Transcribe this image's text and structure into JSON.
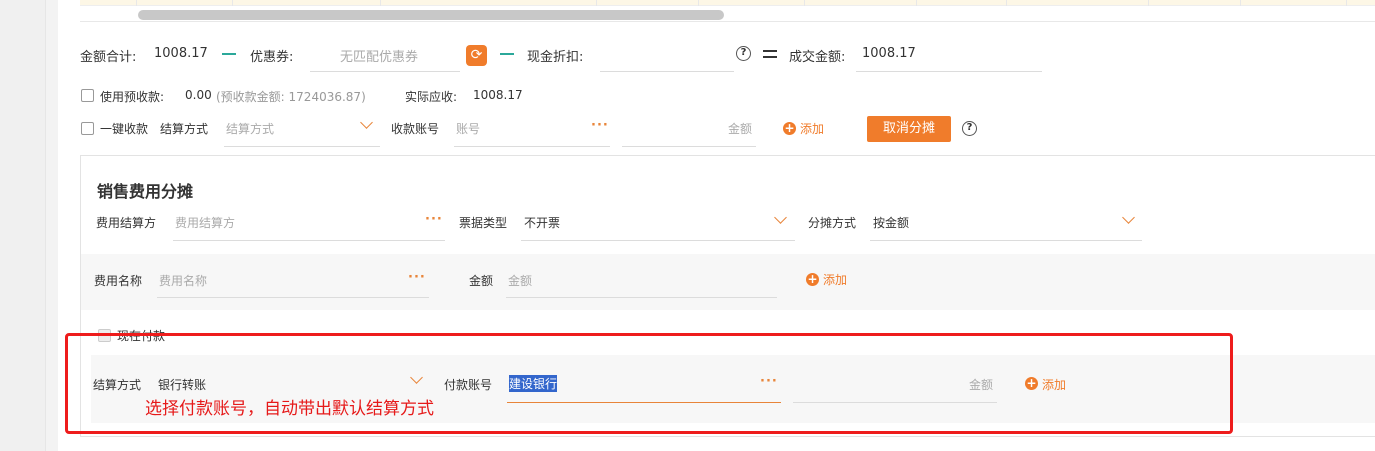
{
  "summary": {
    "total_label": "金额合计:",
    "total_value": "1008.17",
    "coupon_label": "优惠券:",
    "coupon_placeholder": "无匹配优惠券",
    "cash_discount_label": "现金折扣:",
    "deal_label": "成交金额:",
    "deal_value": "1008.17"
  },
  "prepay": {
    "label": "使用预收款:",
    "value": "0.00",
    "balance_text": "(预收款金额: 1724036.87)",
    "actual_label": "实际应收:",
    "actual_value": "1008.17"
  },
  "collect": {
    "one_click_label": "一键收款",
    "method_label": "结算方式",
    "method_placeholder": "结算方式",
    "account_label": "收款账号",
    "account_placeholder": "账号",
    "amount_placeholder": "金额",
    "add_label": "添加",
    "cancel_alloc_label": "取消分摊"
  },
  "allocation": {
    "title": "销售费用分摊",
    "settler_label": "费用结算方",
    "settler_placeholder": "费用结算方",
    "invoice_label": "票据类型",
    "invoice_value": "不开票",
    "alloc_method_label": "分摊方式",
    "alloc_method_value": "按金额",
    "fee_name_label": "费用名称",
    "fee_name_placeholder": "费用名称",
    "amount_label": "金额",
    "amount_placeholder": "金额",
    "add_label": "添加",
    "pay_now_label": "现在付款",
    "pay_method_label": "结算方式",
    "pay_method_value": "银行转账",
    "pay_account_label": "付款账号",
    "pay_account_value": "建设银行",
    "pay_amount_placeholder": "金额",
    "pay_add_label": "添加"
  },
  "annotation": {
    "note": "选择付款账号，自动带出默认结算方式"
  },
  "icons": {
    "refresh": "refresh-icon",
    "help": "question-circle-icon",
    "plus": "plus-circle-icon"
  },
  "colors": {
    "accent": "#f07c2b",
    "minus": "#2ba89a",
    "annotation": "#ee1c1c",
    "selection": "#3366cc"
  }
}
